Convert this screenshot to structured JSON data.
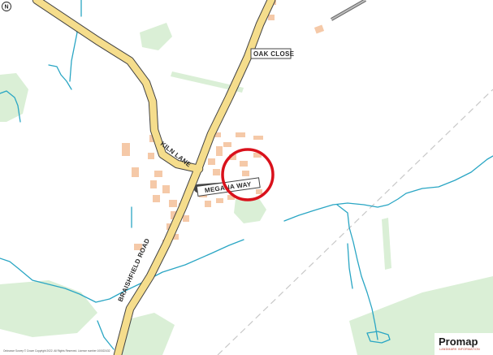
{
  "map": {
    "road_labels": {
      "oak_close": "OAK CLOSE",
      "kiln_lane": "KILN LANE",
      "megana_way": "MEGANA WAY",
      "braishfield_road": "BRAISHFIELD ROAD"
    },
    "copyright_text": "Ordnance Survey © Crown Copyright 2022. All Rights Reserved. Licence number 100022432",
    "north_symbol": "N",
    "icons": [
      "north-arrow-icon",
      "site-marker-circle"
    ],
    "colors": {
      "road_fill": "#f5dd8c",
      "road_casing": "#444444",
      "building": "#f5c9a8",
      "green_area": "#daefd6",
      "water": "#2aa6c4",
      "rail_dash": "#c8c8c8",
      "site_circle": "#d9111b"
    }
  },
  "logo": {
    "name": "Promap",
    "tagline": "LANDMARK INFORMATION"
  }
}
